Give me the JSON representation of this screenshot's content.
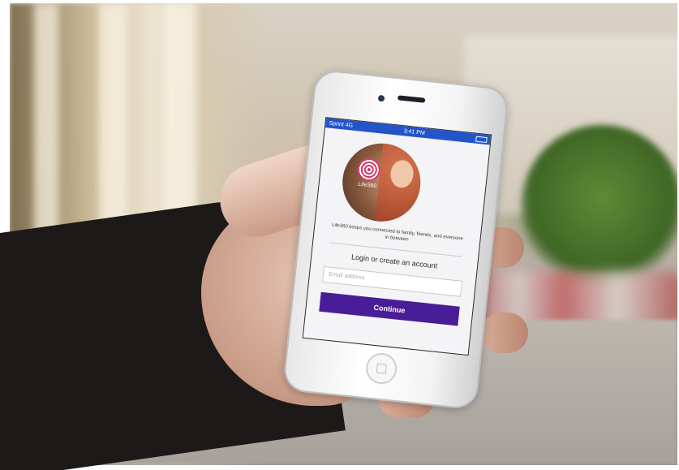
{
  "phone_screen": {
    "status_bar": {
      "carrier": "Sprint 4G",
      "time": "3:41 PM"
    },
    "brand": "Life360",
    "tagline": "Life360 keeps you connected to family, friends, and everyone in between",
    "login_title": "Login or create an account",
    "email_placeholder": "Email address",
    "continue_label": "Continue"
  },
  "colors": {
    "status_bar": "#2354c9",
    "continue_button": "#4a1d98",
    "logo": "#d9366b"
  },
  "icons": [
    "life360-logo-icon",
    "battery-icon",
    "home-button-icon"
  ]
}
